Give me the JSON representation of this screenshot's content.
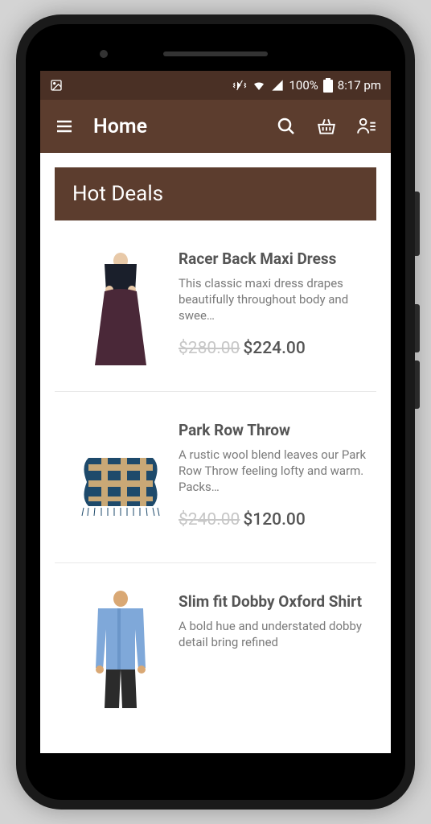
{
  "status": {
    "battery_pct": "100%",
    "time": "8:17 pm"
  },
  "appbar": {
    "title": "Home"
  },
  "section": {
    "title": "Hot Deals"
  },
  "products": [
    {
      "title": "Racer Back Maxi Dress",
      "desc": "This classic maxi dress drapes beautifully throughout body and swee…",
      "old_price": "$280.00",
      "new_price": "$224.00"
    },
    {
      "title": "Park Row Throw",
      "desc": "A rustic wool blend leaves our Park Row Throw feeling lofty and warm. Packs…",
      "old_price": "$240.00",
      "new_price": "$120.00"
    },
    {
      "title": "Slim fit Dobby Oxford Shirt",
      "desc": "A bold hue and understated dobby detail bring refined",
      "old_price": "",
      "new_price": ""
    }
  ]
}
